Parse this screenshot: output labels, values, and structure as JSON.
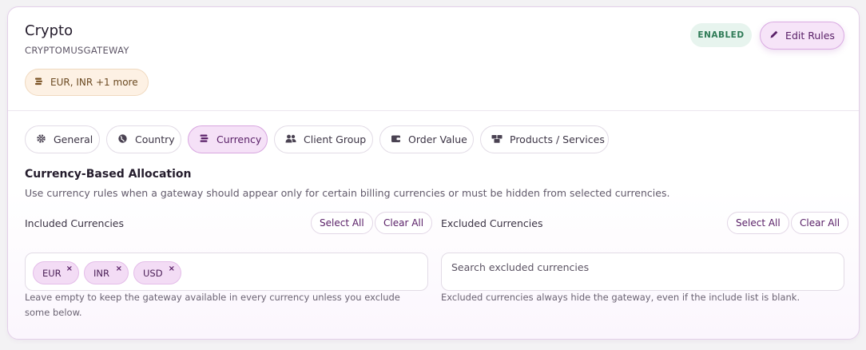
{
  "gateway": {
    "title": "Crypto",
    "code": "CRYPTOMUSGATEWAY",
    "currency_summary": "EUR, INR +1 more",
    "status": "ENABLED",
    "edit_label": "Edit Rules"
  },
  "tabs": [
    {
      "label": "General",
      "icon": "gear-icon"
    },
    {
      "label": "Country",
      "icon": "globe-icon"
    },
    {
      "label": "Currency",
      "icon": "coins-icon",
      "active": true
    },
    {
      "label": "Client Group",
      "icon": "users-icon"
    },
    {
      "label": "Order Value",
      "icon": "wallet-icon"
    },
    {
      "label": "Products / Services",
      "icon": "boxes-icon"
    }
  ],
  "section": {
    "title": "Currency-Based Allocation",
    "description": "Use currency rules when a gateway should appear only for certain billing currencies or must be hidden from selected currencies."
  },
  "included": {
    "label": "Included Currencies",
    "select_all": "Select All",
    "clear_all": "Clear All",
    "chips": [
      "EUR",
      "INR",
      "USD"
    ],
    "remove_glyph": "×",
    "help": "Leave empty to keep the gateway available in every currency unless you exclude some below."
  },
  "excluded": {
    "label": "Excluded Currencies",
    "select_all": "Select All",
    "clear_all": "Clear All",
    "placeholder": "Search excluded currencies",
    "help": "Excluded currencies always hide the gateway, even if the include list is blank."
  },
  "colors": {
    "accent": "#5a2168",
    "active_tab_bg": "#f5e1f7",
    "enabled_bg": "#e7f4ee",
    "enabled_text": "#2e7a56",
    "currency_pill_bg": "#fdf1e4"
  }
}
